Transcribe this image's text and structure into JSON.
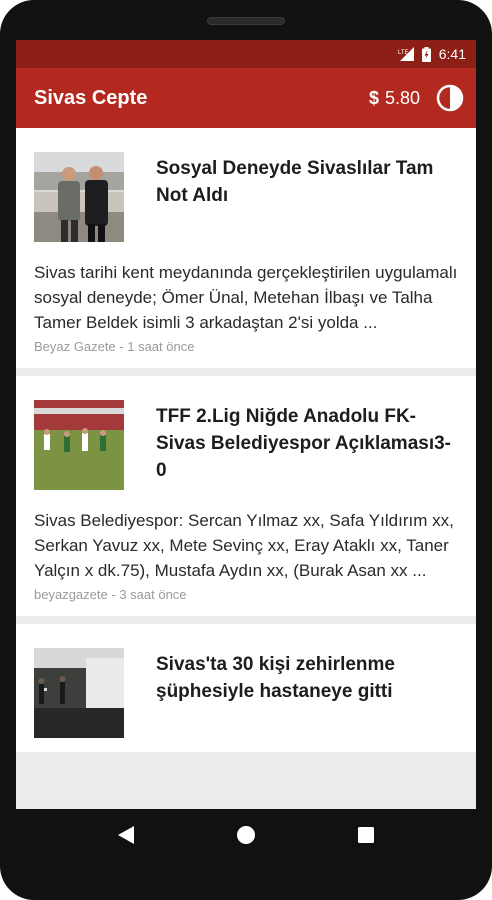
{
  "status_bar": {
    "time": "6:41",
    "signal_icon": "signal-lte-icon",
    "battery_icon": "battery-charging-icon"
  },
  "app_bar": {
    "title": "Sivas Cepte",
    "currency_symbol": "$",
    "balance": "5.80",
    "theme_icon": "contrast-icon",
    "color": "#b3291f"
  },
  "articles": [
    {
      "title": "Sosyal Deneyde Sivaslılar Tam Not Aldı",
      "summary": "Sivas tarihi kent meydanında gerçekleştirilen uygulamalı sosyal deneyde; Ömer Ünal, Metehan İlbaşı ve Talha Tamer Beldek isimli 3 arkadaştan 2'si yolda ...",
      "source": "Beyaz Gazete",
      "time": "1 saat önce"
    },
    {
      "title": "TFF 2.Lig Niğde Anadolu FK- Sivas Belediyespor Açıklaması3-0",
      "summary": "Sivas Belediyespor: Sercan Yılmaz xx, Safa Yıldırım xx, Serkan Yavuz xx, Mete Sevinç xx, Eray Ataklı xx, Taner Yalçın x dk.75), Mustafa Aydın xx, (Burak Asan xx ...",
      "source": "beyazgazete",
      "time": "3 saat önce"
    },
    {
      "title": "Sivas'ta 30 kişi zehirlenme şüphesiyle hastaneye gitti",
      "summary": "",
      "source": "",
      "time": ""
    }
  ],
  "nav_bar": {
    "back_icon": "back-triangle-icon",
    "home_icon": "home-circle-icon",
    "recents_icon": "recents-square-icon"
  }
}
